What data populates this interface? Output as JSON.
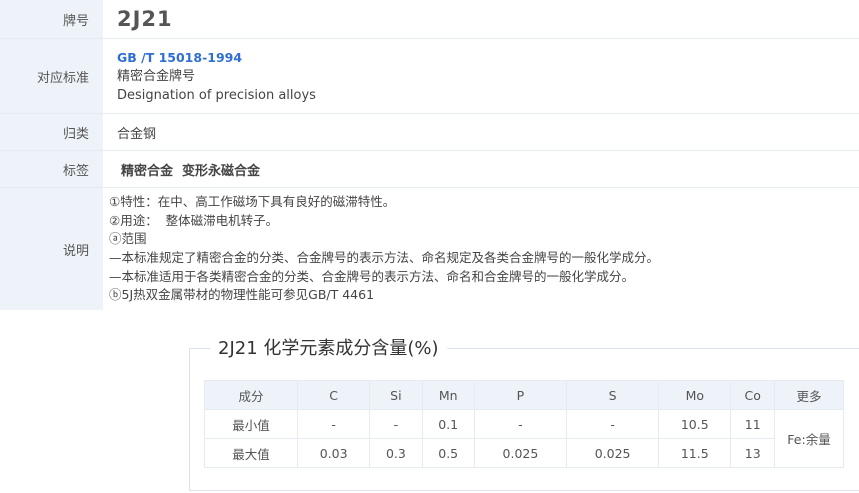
{
  "rows": {
    "grade": {
      "label": "牌号",
      "value": "2J21"
    },
    "standard": {
      "label": "对应标准",
      "code": "GB /T 15018-1994",
      "name_cn": "精密合金牌号",
      "name_en": "Designation of precision alloys"
    },
    "category": {
      "label": "归类",
      "value": "合金钢"
    },
    "tags": {
      "label": "标签",
      "value": "精密合金  变形永磁合金"
    },
    "desc": {
      "label": "说明",
      "lines": [
        "①特性：在中、高工作磁场下具有良好的磁滞特性。",
        "②用途：  整体磁滞电机转子。",
        "ⓐ范围",
        "—本标准规定了精密合金的分类、合金牌号的表示方法、命名规定及各类合金牌号的一般化学成分。",
        "—本标准适用于各类精密合金的分类、合金牌号的表示方法、命名和合金牌号的一般化学成分。",
        "ⓑ5J热双金属带材的物理性能可参见GB/T 4461"
      ]
    }
  },
  "chem": {
    "title": "2J21 化学元素成分含量(%)",
    "header": [
      "成分",
      "C",
      "Si",
      "Mn",
      "P",
      "S",
      "Mo",
      "Co",
      "更多"
    ],
    "min_row": [
      "最小值",
      "-",
      "-",
      "0.1",
      "-",
      "-",
      "10.5",
      "11"
    ],
    "max_row": [
      "最大值",
      "0.03",
      "0.3",
      "0.5",
      "0.025",
      "0.025",
      "11.5",
      "13"
    ],
    "more": "Fe:余量"
  }
}
